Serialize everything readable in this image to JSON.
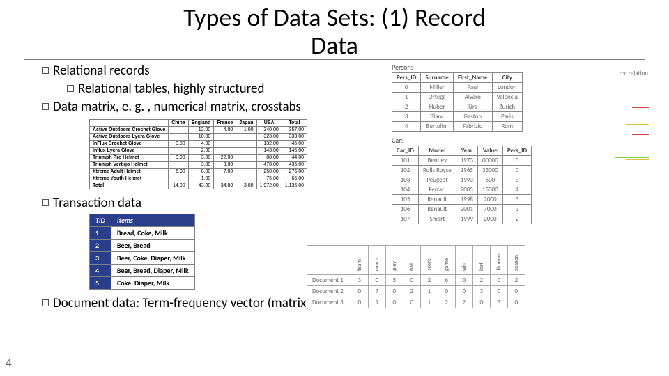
{
  "page_number": "4",
  "title_line1": "Types of Data Sets: (1) Record",
  "title_line2": "Data",
  "bullets": {
    "b1": "Relational records",
    "b1a": "Relational tables, highly structured",
    "b2": "Data matrix, e. g. , numerical matrix, crosstabs",
    "b3": "Transaction data",
    "b4": "Document data: Term-frequency vector (matrix) of text documents"
  },
  "crosstab": {
    "cols": [
      "",
      "China",
      "England",
      "France",
      "Japan",
      "USA",
      "Total"
    ],
    "rows": [
      [
        "Active Outdoors Crochet Glove",
        "",
        "12.00",
        "4.00",
        "1.00",
        "340.00",
        "357.00"
      ],
      [
        "Active Outdoors Lycra Glove",
        "",
        "10.00",
        "",
        "",
        "323.00",
        "333.00"
      ],
      [
        "InFlux Crochet Glove",
        "3.00",
        "4.00",
        "",
        "",
        "132.00",
        "45.00"
      ],
      [
        "Influx Lycra Glove",
        "",
        "2.00",
        "",
        "",
        "143.00",
        "145.00"
      ],
      [
        "Triumph Pro Helmet",
        "3.00",
        "3.00",
        "22.00",
        "",
        "88.00",
        "44.00"
      ],
      [
        "Triumph Vertigo Helmet",
        "",
        "3.00",
        "3.00",
        "",
        "478.00",
        "435.00"
      ],
      [
        "Xtreme Adult Helmet",
        "6.00",
        "8.00",
        "7.00",
        "",
        "250.00",
        "276.00"
      ],
      [
        "Xtreme Youth Helmet",
        "",
        "1.00",
        "",
        "",
        "75.00",
        "65.00"
      ],
      [
        "Total",
        "14.00",
        "43.00",
        "34.00",
        "3.00",
        "1,972.00",
        "1,136.00"
      ]
    ]
  },
  "transactions": {
    "head": [
      "TID",
      "Items"
    ],
    "rows": [
      [
        "1",
        "Bread, Coke, Milk"
      ],
      [
        "2",
        "Beer, Bread"
      ],
      [
        "3",
        "Beer, Coke, Diaper, Milk"
      ],
      [
        "4",
        "Beer, Bread, Diaper, Milk"
      ],
      [
        "5",
        "Coke, Diaper, Milk"
      ]
    ]
  },
  "person": {
    "label": "Person:",
    "head": [
      "Pers_ID",
      "Surname",
      "First_Name",
      "City"
    ],
    "rows": [
      [
        "0",
        "Miller",
        "Paul",
        "London"
      ],
      [
        "1",
        "Ortega",
        "Alvaro",
        "Valencia"
      ],
      [
        "2",
        "Huber",
        "Urs",
        "Zurich"
      ],
      [
        "3",
        "Blanc",
        "Gaston",
        "Paris"
      ],
      [
        "4",
        "Bertolini",
        "Fabrizio",
        "Rom"
      ]
    ],
    "annotation": "n:c relation"
  },
  "car": {
    "label": "Car:",
    "head": [
      "Car_ID",
      "Model",
      "Year",
      "Value",
      "Pers_ID"
    ],
    "rows": [
      [
        "101",
        "Bentley",
        "1973",
        "00000",
        "0"
      ],
      [
        "102",
        "Rolls Royce",
        "1965",
        "33000",
        "0"
      ],
      [
        "103",
        "Peugeot",
        "1993",
        "500",
        "3"
      ],
      [
        "104",
        "Ferrari",
        "2005",
        "15000",
        "4"
      ],
      [
        "105",
        "Renault",
        "1998",
        "2000",
        "3"
      ],
      [
        "106",
        "Renault",
        "2001",
        "7000",
        "3"
      ],
      [
        "107",
        "Smart",
        "1999",
        "2000",
        "2"
      ]
    ]
  },
  "termfreq": {
    "cols": [
      "team",
      "coach",
      "play",
      "ball",
      "score",
      "game",
      "win",
      "lost",
      "timeout",
      "season"
    ],
    "rows": [
      [
        "Document 1",
        "3",
        "0",
        "5",
        "0",
        "2",
        "6",
        "0",
        "2",
        "0",
        "2"
      ],
      [
        "Document 2",
        "0",
        "7",
        "0",
        "2",
        "1",
        "0",
        "0",
        "3",
        "0",
        "0"
      ],
      [
        "Document 3",
        "0",
        "1",
        "0",
        "0",
        "1",
        "2",
        "2",
        "0",
        "3",
        "0"
      ]
    ]
  },
  "link_colors": [
    "#d83b3b",
    "#d8c23b",
    "#3bb4d8",
    "#7ad83b"
  ]
}
